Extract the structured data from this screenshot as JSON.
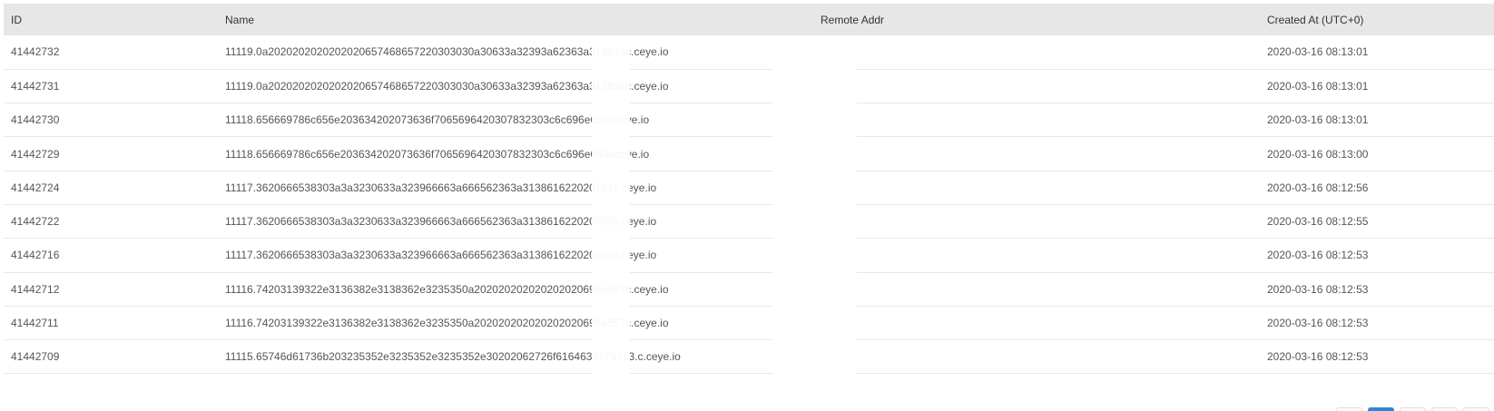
{
  "table": {
    "headers": {
      "id": "ID",
      "name": "Name",
      "remote": "Remote Addr",
      "created": "Created At (UTC+0)"
    },
    "rows": [
      {
        "id": "41442732",
        "name": "11119.0a2020202020202020657468657220303030a30633a32393a62363a31383a",
        "name_suffix": "c.ceye.io",
        "remote": "",
        "created": "2020-03-16 08:13:01"
      },
      {
        "id": "41442731",
        "name": "11119.0a2020202020202020657468657220303030a30633a32393a62363a31383a",
        "name_suffix": "c.ceye.io",
        "remote": "",
        "created": "2020-03-16 08:13:01"
      },
      {
        "id": "41442730",
        "name": "11118.656669786c656e203634202073636f7065696420307832303c6c696e6b3e",
        "name_suffix": "ceye.io",
        "remote": "",
        "created": "2020-03-16 08:13:01"
      },
      {
        "id": "41442729",
        "name": "11118.656669786c656e203634202073636f7065696420307832303c6c696e6b3e",
        "name_suffix": "ceye.io",
        "remote": "",
        "created": "2020-03-16 08:13:00"
      },
      {
        "id": "41442724",
        "name": "11117.3620666538303a3a3230633a323966663a666562363a313861622020707",
        "name_suffix": "c.ceye.io",
        "remote": "",
        "created": "2020-03-16 08:12:56"
      },
      {
        "id": "41442722",
        "name": "11117.3620666538303a3a3230633a323966663a666562363a313861622020707",
        "name_suffix": "c.ceye.io",
        "remote": "",
        "created": "2020-03-16 08:12:55"
      },
      {
        "id": "41442716",
        "name": "11117.3620666538303a3a3230633a323966663a666562363a313861622020707",
        "name_suffix": "c.ceye.io",
        "remote": "",
        "created": "2020-03-16 08:12:53"
      },
      {
        "id": "41442712",
        "name": "11116.74203139322e3136382e3138362e3235350a202020202020202020696e657",
        "name_suffix": "c.ceye.io",
        "remote": "",
        "created": "2020-03-16 08:12:53"
      },
      {
        "id": "41442711",
        "name": "11116.74203139322e3136382e3138362e3235350a202020202020202020696e657",
        "name_suffix": "c.ceye.io",
        "remote": "",
        "created": "2020-03-16 08:12:53"
      },
      {
        "id": "41442709",
        "name": "11115.65746d61736b203235352e3235352e3235352e30202062726f6164636173",
        "name_suffix": "173.c.ceye.io",
        "remote": "",
        "created": "2020-03-16 08:12:53"
      }
    ]
  },
  "pagination": {
    "pages": [
      "",
      "",
      "",
      "",
      ""
    ],
    "active_index": 1,
    "accent": "#2f86d6"
  }
}
